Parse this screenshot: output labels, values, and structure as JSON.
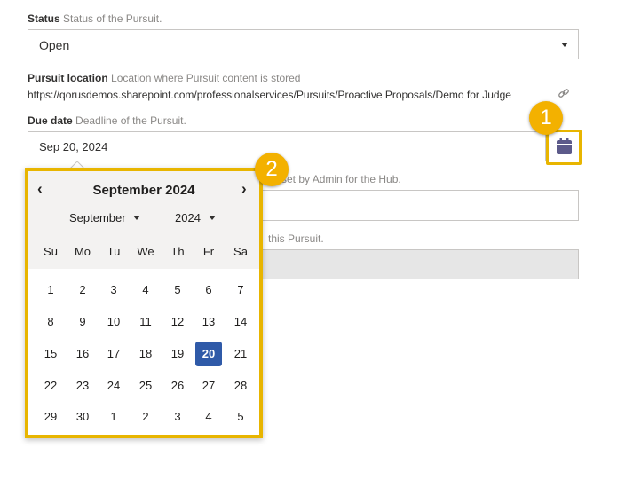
{
  "status": {
    "label": "Status",
    "description": "Status of the Pursuit.",
    "value": "Open"
  },
  "location": {
    "label": "Pursuit location",
    "description": "Location where Pursuit content is stored",
    "url": "https://qorusdemos.sharepoint.com/professionalservices/Pursuits/Proactive Proposals/Demo for Judge"
  },
  "due_date": {
    "label": "Due date",
    "description": "Deadline of the Pursuit.",
    "value": "Sep 20, 2024"
  },
  "hidden_field_1": {
    "description_fragment": "set by Admin for the Hub."
  },
  "hidden_field_2": {
    "description_fragment": "this Pursuit."
  },
  "callouts": {
    "one": "1",
    "two": "2"
  },
  "calendar": {
    "title": "September 2024",
    "month_select": "September",
    "year_select": "2024",
    "prev": "‹",
    "next": "›",
    "weekdays": [
      "Su",
      "Mo",
      "Tu",
      "We",
      "Th",
      "Fr",
      "Sa"
    ],
    "weeks": [
      [
        "1",
        "2",
        "3",
        "4",
        "5",
        "6",
        "7"
      ],
      [
        "8",
        "9",
        "10",
        "11",
        "12",
        "13",
        "14"
      ],
      [
        "15",
        "16",
        "17",
        "18",
        "19",
        "20",
        "21"
      ],
      [
        "22",
        "23",
        "24",
        "25",
        "26",
        "27",
        "28"
      ],
      [
        "29",
        "30",
        "1",
        "2",
        "3",
        "4",
        "5"
      ]
    ],
    "selected_day": "20"
  },
  "colors": {
    "highlight": "#e8b500",
    "selected": "#2f5aa8",
    "calendar_icon": "#5c5a8a"
  }
}
